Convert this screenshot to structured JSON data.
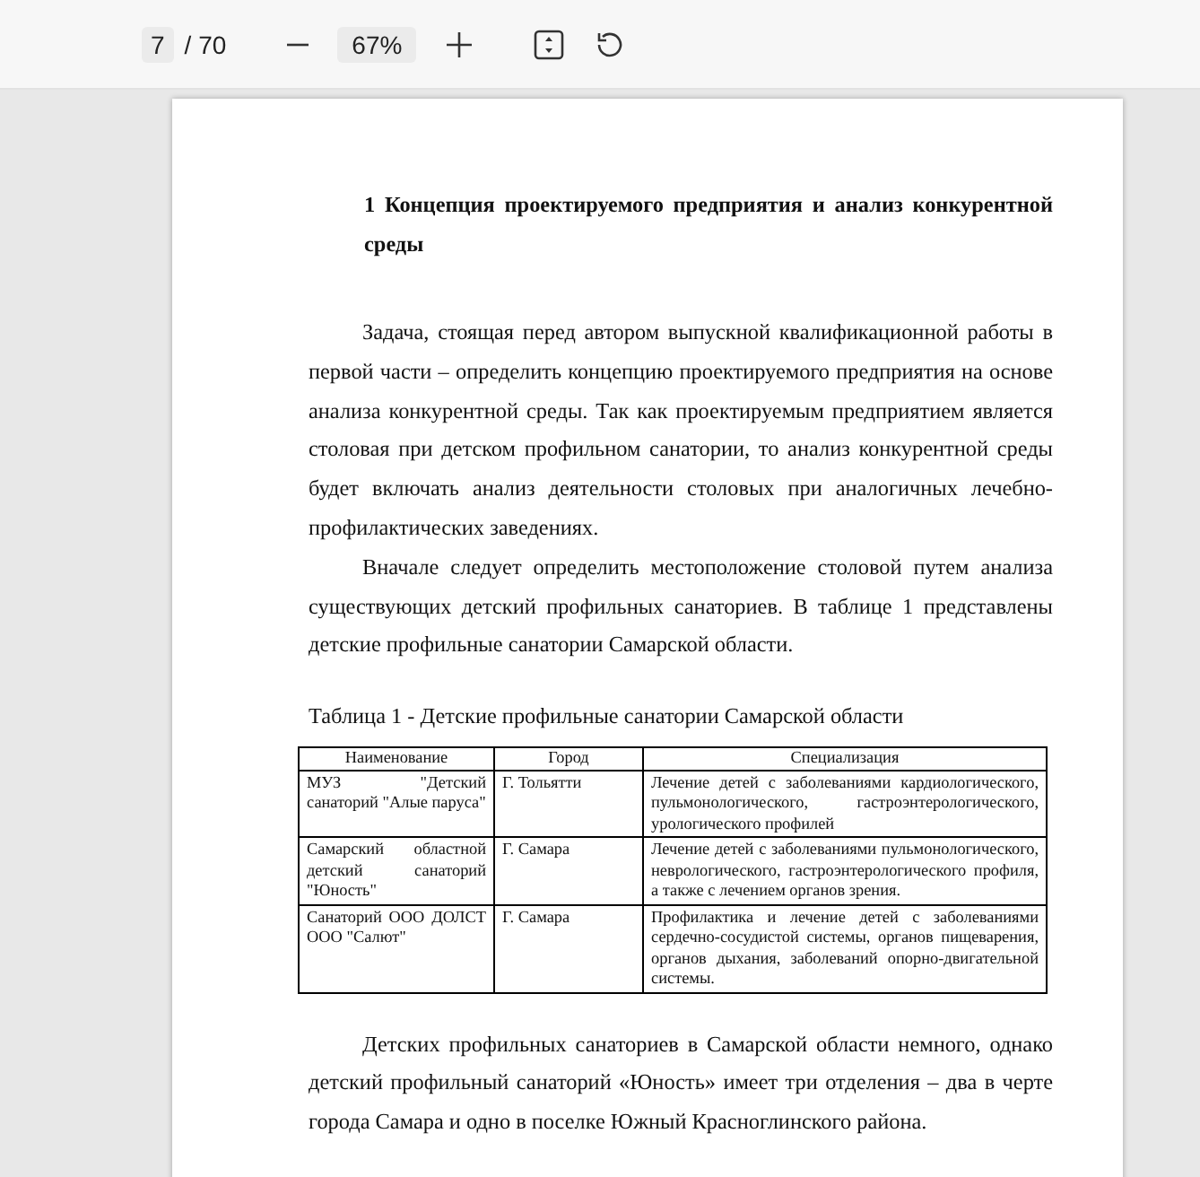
{
  "toolbar": {
    "page_current": "7",
    "page_total": "/ 70",
    "zoom": "67%"
  },
  "document": {
    "heading": "1 Концепция проектируемого предприятия и анализ конкурентной среды",
    "paragraphs_before": [
      "Задача, стоящая перед автором выпускной квалификационной работы в первой части – определить концепцию проектируемого предприятия на основе анализа конкурентной среды. Так как проектируемым предприятием является столовая при детском профильном санатории, то анализ конкурентной среды будет включать анализ деятельности столовых при аналогичных лечебно-профилактических заведениях.",
      "Вначале следует определить местоположение столовой путем анализа существующих детский профильных санаториев. В таблице 1 представлены детские профильные санатории Самарской области."
    ],
    "table": {
      "caption": "Таблица 1 - Детские профильные санатории Самарской области",
      "columns": [
        "Наименование",
        "Город",
        "Специализация"
      ],
      "rows": [
        [
          "МУЗ \"Детский санаторий \"Алые паруса\"",
          "Г. Тольятти",
          "Лечение детей с заболеваниями кардиологического, пульмонологического, гастроэнтерологического, урологического профилей"
        ],
        [
          "Самарский областной детский санаторий \"Юность\"",
          "Г. Самара",
          "Лечение детей с заболеваниями пульмонологического, неврологического, гастроэнтерологического профиля, а также с лечением органов зрения."
        ],
        [
          "Санаторий ООО ДОЛСТ ООО \"Салют\"",
          "Г. Самара",
          "Профилактика и лечение детей с заболеваниями сердечно-сосудистой системы, органов пищеварения, органов дыхания, заболеваний опорно-двигательной системы."
        ]
      ]
    },
    "paragraphs_after": [
      "Детских профильных санаториев в Самарской области немного, однако детский профильный санаторий «Юность» имеет три отделения – два в черте города Самара и одно в поселке Южный Красноглинского района."
    ]
  }
}
